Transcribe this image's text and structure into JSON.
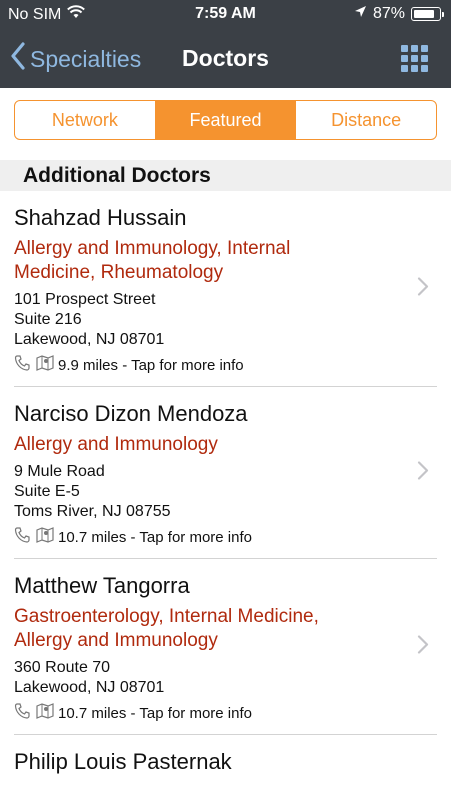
{
  "status_bar": {
    "carrier": "No SIM",
    "time": "7:59 AM",
    "battery": "87%",
    "battery_level": 0.87
  },
  "nav": {
    "back_label": "Specialties",
    "title": "Doctors",
    "grid_icon": "grid-menu-icon"
  },
  "segments": [
    {
      "label": "Network",
      "active": false
    },
    {
      "label": "Featured",
      "active": true
    },
    {
      "label": "Distance",
      "active": false
    }
  ],
  "section": {
    "title": "Additional Doctors"
  },
  "doctors": [
    {
      "name": "Shahzad Hussain",
      "specialties": [
        "Allergy and Immunology, Internal",
        "Medicine, Rheumatology"
      ],
      "address": [
        "101 Prospect Street",
        "Suite 216",
        "Lakewood, NJ 08701"
      ],
      "distance_text": "9.9 miles - Tap for more info"
    },
    {
      "name": "Narciso Dizon Mendoza",
      "specialties": [
        "Allergy and Immunology"
      ],
      "address": [
        "9 Mule Road",
        "Suite E-5",
        "Toms River, NJ 08755"
      ],
      "distance_text": "10.7 miles - Tap for more info"
    },
    {
      "name": "Matthew Tangorra",
      "specialties": [
        "Gastroenterology, Internal Medicine,",
        "Allergy and Immunology"
      ],
      "address": [
        "360 Route 70",
        "Lakewood, NJ 08701"
      ],
      "distance_text": "10.7 miles - Tap for more info"
    },
    {
      "name": "Philip Louis Pasternak",
      "specialties": [],
      "address": [],
      "distance_text": ""
    }
  ],
  "colors": {
    "nav_bg": "#3b4046",
    "accent": "#f5932f",
    "link": "#8fb8e0",
    "specialty": "#b02a0e"
  }
}
